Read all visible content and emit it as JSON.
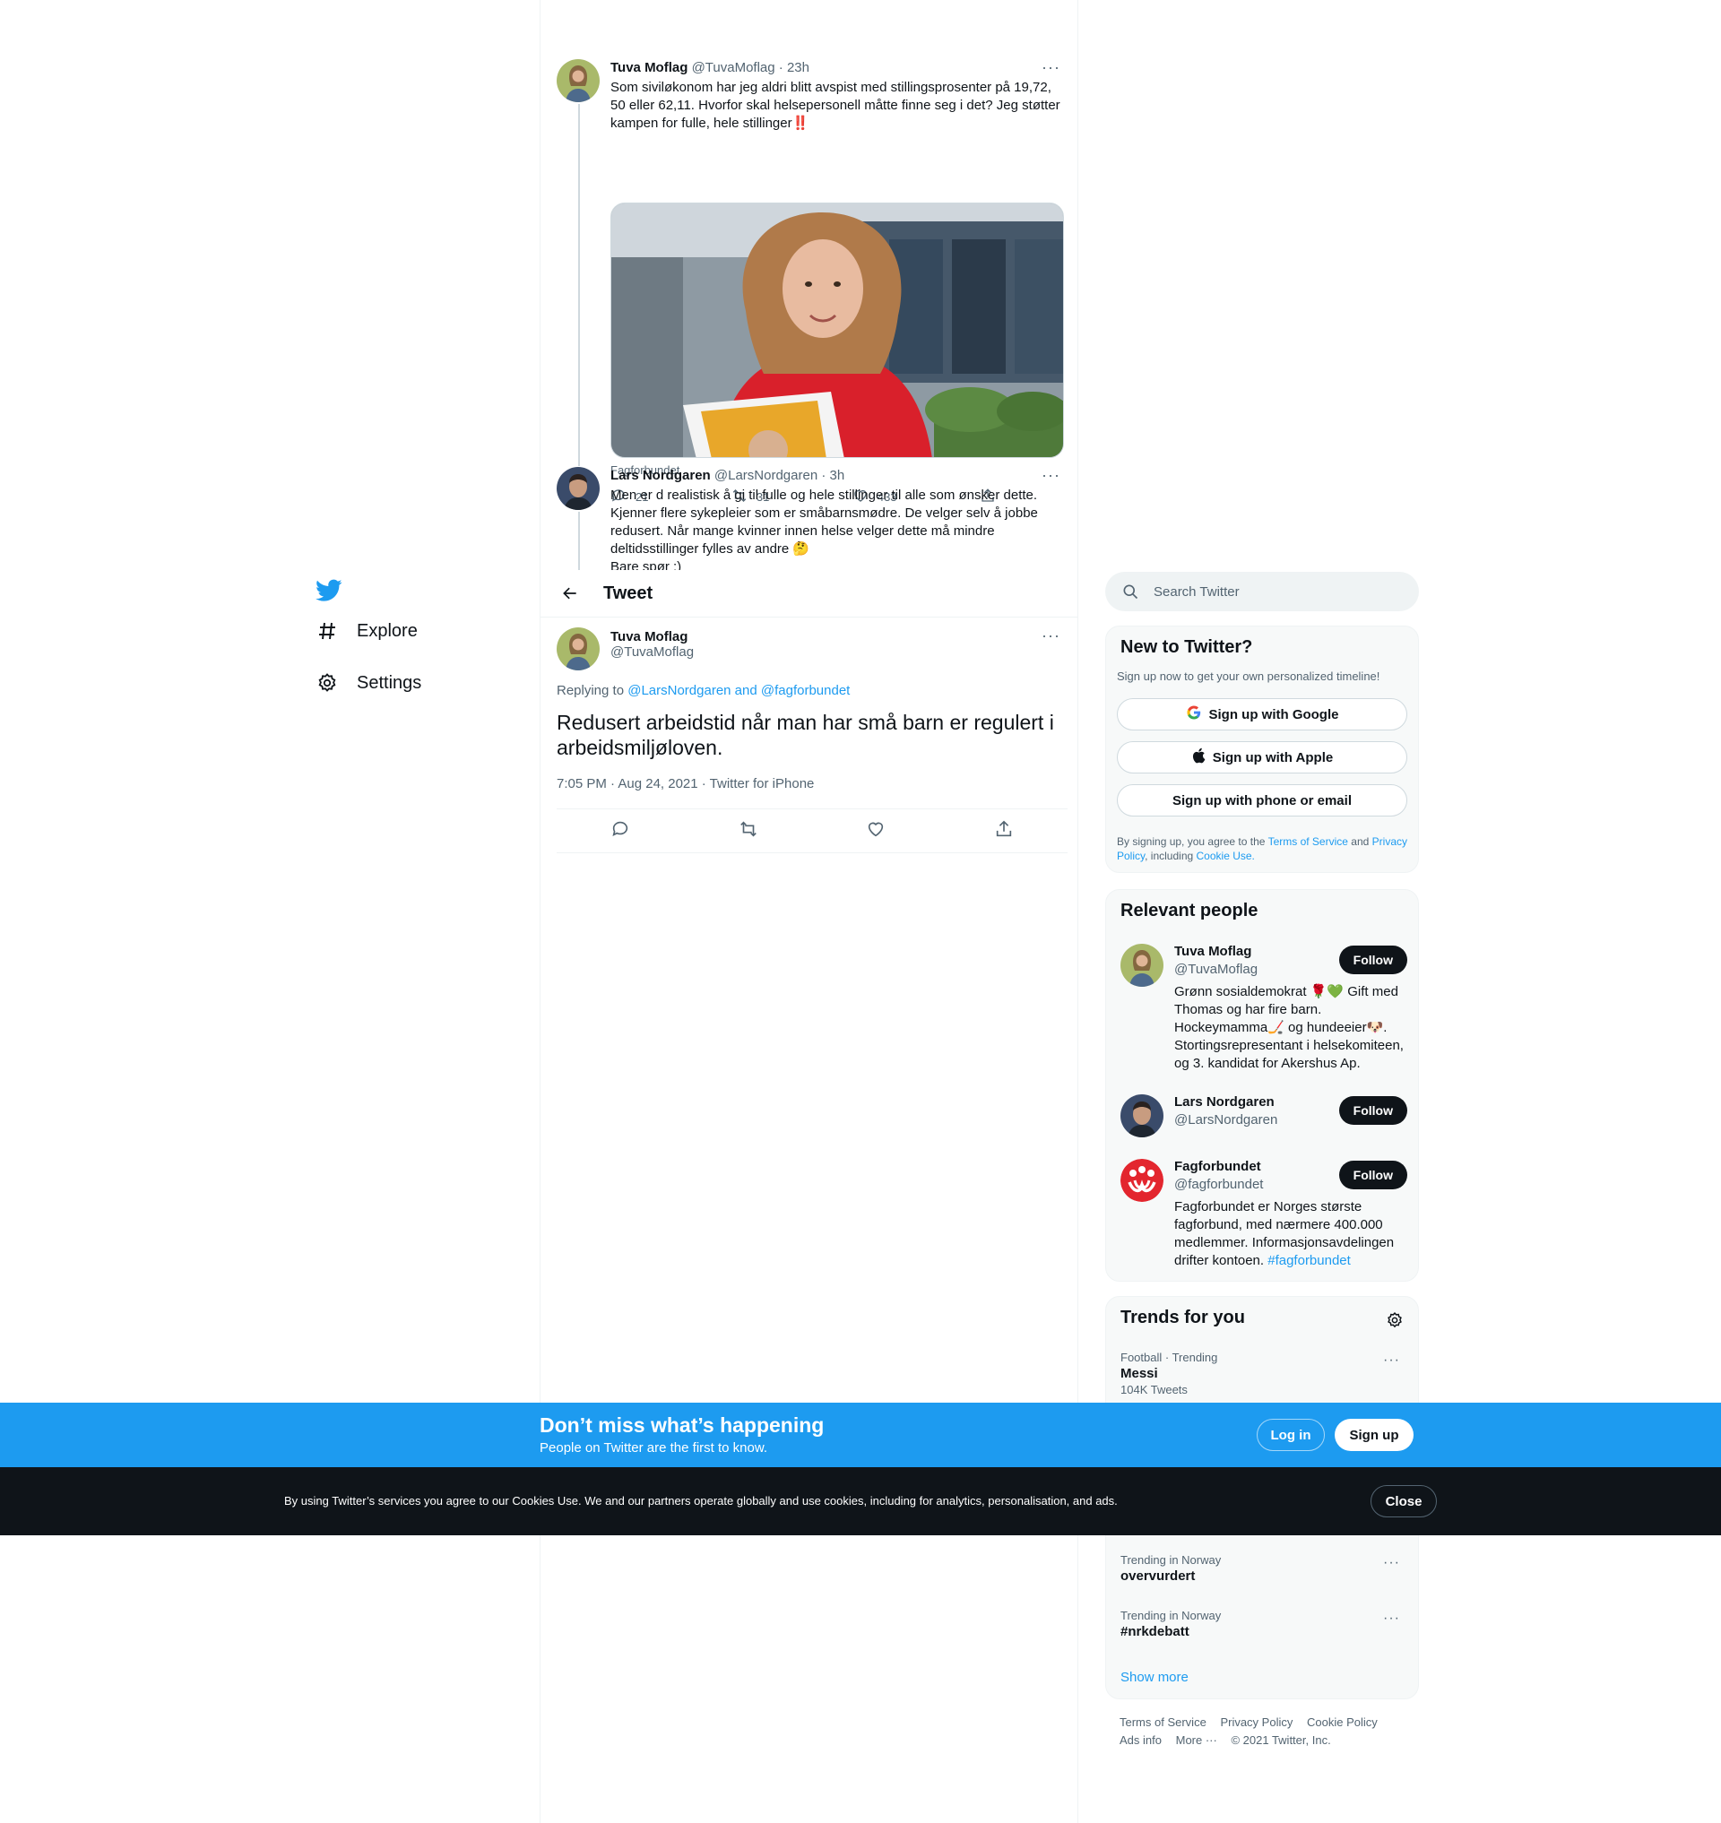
{
  "nav": {
    "explore_label": "Explore",
    "settings_label": "Settings"
  },
  "thread": {
    "tweet1": {
      "name": "Tuva Moflag",
      "handle": "@TuvaMoflag",
      "time": "· 23h",
      "text": "Som siviløkonom har jeg aldri blitt avspist med stillingsprosenter på 19,72, 50 eller 62,11. Hvorfor skal helsepersonell måtte finne seg i det? Jeg støtter kampen for fulle, hele stillinger",
      "emoji": "‼️",
      "media_caption": "Fagforbundet",
      "replies": "21",
      "retweets": "31",
      "likes": "433"
    },
    "tweet2": {
      "name": "Lars Nordgaren",
      "handle": "@LarsNordgaren",
      "time": "· 3h",
      "text": "Men er d realistisk å gi til fulle og hele stillinger til alle som ønsker dette. Kjenner flere sykepleier som er småbarnsmødre. De velger selv å jobbe redusert. Når mange kvinner innen helse velger dette må mindre deltidsstillinger fylles av andre 🤔",
      "text_cut": "Bare spør :)"
    }
  },
  "header": {
    "title": "Tweet"
  },
  "focus": {
    "name": "Tuva Moflag",
    "handle": "@TuvaMoflag",
    "replying_prefix": "Replying to",
    "replying_to": "@LarsNordgaren and @fagforbundet",
    "text": "Redusert arbeidstid når man har små barn er regulert i arbeidsmiljøloven.",
    "meta": "7:05 PM · Aug 24, 2021 · Twitter for iPhone"
  },
  "search": {
    "placeholder": "Search Twitter"
  },
  "signup_card": {
    "title": "New to Twitter?",
    "subtitle": "Sign up now to get your own personalized timeline!",
    "google_label": "Sign up with Google",
    "apple_label": "Sign up with Apple",
    "phone_label": "Sign up with phone or email",
    "terms_prefix": "By signing up, you agree to the",
    "terms_link": "Terms of Service",
    "terms_and": "and",
    "privacy_link": "Privacy Policy",
    "terms_including": ", including",
    "cookie_link": "Cookie Use."
  },
  "relevant": {
    "title": "Relevant people",
    "follow_label": "Follow",
    "people": [
      {
        "name": "Tuva Moflag",
        "handle": "@TuvaMoflag",
        "bio": "Grønn sosialdemokrat 🌹💚 Gift med Thomas og har fire barn. Hockeymamma🏒 og hundeeier🐶. Stortingsrepresentant i helsekomiteen, og 3. kandidat for Akershus Ap."
      },
      {
        "name": "Lars Nordgaren",
        "handle": "@LarsNordgaren"
      },
      {
        "name": "Fagforbundet",
        "handle": "@fagforbundet",
        "bio": "Fagforbundet er Norges største fagforbund, med nærmere 400.000 medlemmer. Informasjonsavdelingen drifter kontoen.",
        "bio_link": "#fagforbundet"
      }
    ]
  },
  "trends": {
    "title": "Trends for you",
    "items": [
      {
        "context": "Football · Trending",
        "name": "Messi",
        "count": "104K Tweets"
      },
      {
        "context": "Trending in Norway",
        "name": "overvurdert"
      },
      {
        "context": "Trending in Norway",
        "name": "#nrkdebatt"
      }
    ],
    "show_more": "Show more"
  },
  "footer": {
    "terms": "Terms of Service",
    "privacy": "Privacy Policy",
    "cookie": "Cookie Policy",
    "ads": "Ads info",
    "more": "More ···",
    "copyright": "© 2021 Twitter, Inc."
  },
  "signup_bar": {
    "heading": "Don’t miss what’s happening",
    "sub": "People on Twitter are the first to know.",
    "login_label": "Log in",
    "signup_label": "Sign up"
  },
  "cookie_bar": {
    "text": "By using Twitter’s services you agree to our Cookies Use. We and our partners operate globally and use cookies, including for analytics, personalisation, and ads.",
    "close_label": "Close"
  },
  "colors": {
    "accent": "#1d9bf0",
    "text": "#0f1419",
    "muted": "#536471",
    "dark": "#0f1419"
  }
}
